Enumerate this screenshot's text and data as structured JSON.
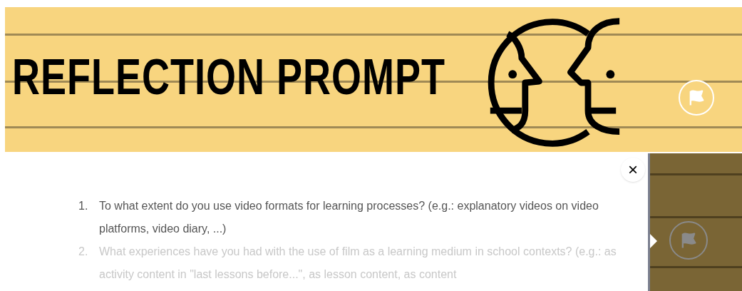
{
  "banner": {
    "title": "REFLECTION PROMPT"
  },
  "popup": {
    "close_label": "×",
    "items": [
      {
        "number": "1.",
        "text": "To what extent do you use video formats for learning processes? (e.g.: explanatory videos on video platforms, video diary, ...)",
        "dimmed": false
      },
      {
        "number": "2.",
        "text": "What experiences have you had with the use of film as a learning medium in school contexts? (e.g.: as activity content in \"last lessons before...\", as lesson content, as content",
        "dimmed": true
      }
    ]
  }
}
